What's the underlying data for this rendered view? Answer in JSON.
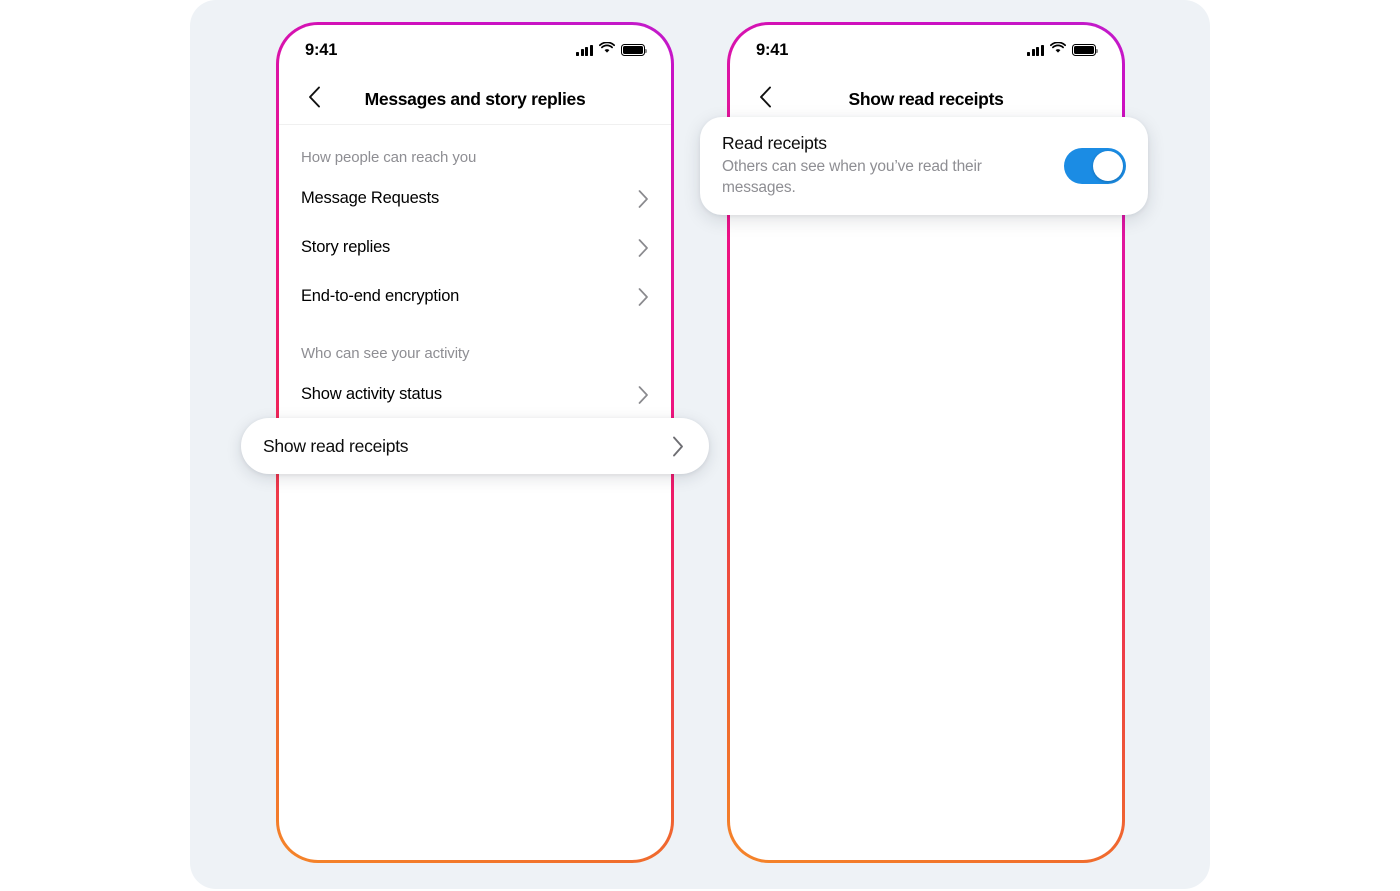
{
  "canvas": {
    "background_color": "#ffffff",
    "panel_color": "#eef2f6"
  },
  "theme": {
    "gradient_start": "#f58529",
    "gradient_mid": "#ed1187",
    "gradient_end": "#c11ccb",
    "toggle_on_color": "#1b8ce4",
    "muted_text_color": "#8e8e93"
  },
  "phones": [
    {
      "name": "messages-and-story-replies",
      "status_bar": {
        "time": "9:41",
        "icons": [
          "signal-bars-icon",
          "wifi-icon",
          "battery-icon"
        ]
      },
      "nav": {
        "back_icon": "chevron-left-icon",
        "title": "Messages and story replies"
      },
      "list": [
        {
          "type": "section",
          "label": "How people can reach you"
        },
        {
          "type": "row",
          "label": "Message Requests",
          "accessory": "chevron-right-icon"
        },
        {
          "type": "row",
          "label": "Story replies",
          "accessory": "chevron-right-icon"
        },
        {
          "type": "row",
          "label": "End-to-end encryption",
          "accessory": "chevron-right-icon"
        },
        {
          "type": "section",
          "label": "Who can see your activity"
        },
        {
          "type": "row",
          "label": "Show activity status",
          "accessory": "chevron-right-icon"
        }
      ],
      "highlight_pill": {
        "label": "Show read receipts",
        "accessory": "chevron-right-icon"
      }
    },
    {
      "name": "show-read-receipts",
      "status_bar": {
        "time": "9:41",
        "icons": [
          "signal-bars-icon",
          "wifi-icon",
          "battery-icon"
        ]
      },
      "nav": {
        "back_icon": "chevron-left-icon",
        "title": "Show read receipts"
      },
      "highlight_card": {
        "title": "Read receipts",
        "subtitle": "Others can see when you’ve read their messages.",
        "toggle_state": "on"
      }
    }
  ]
}
